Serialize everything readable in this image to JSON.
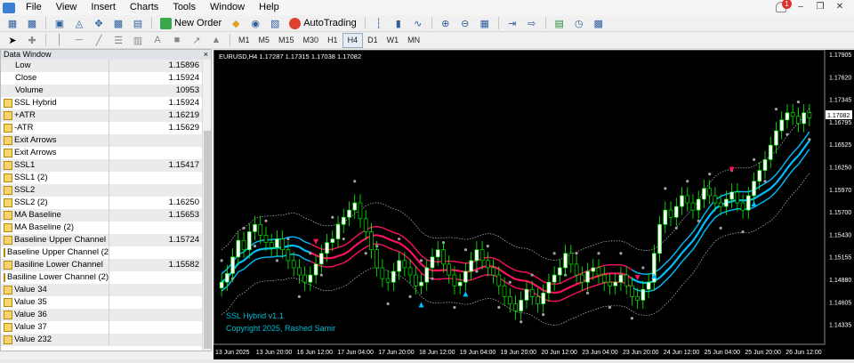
{
  "menu": {
    "items": [
      "File",
      "View",
      "Insert",
      "Charts",
      "Tools",
      "Window",
      "Help"
    ],
    "notifications": "1"
  },
  "toolbar": {
    "new_order": "New Order",
    "autotrading": "AutoTrading",
    "timeframes": [
      "M1",
      "M5",
      "M15",
      "M30",
      "H1",
      "H4",
      "D1",
      "W1",
      "MN"
    ],
    "active_timeframe": "H4"
  },
  "data_window": {
    "title": "Data Window",
    "rows": [
      {
        "name": "Low",
        "value": "1.15896",
        "indicator": false
      },
      {
        "name": "Close",
        "value": "1.15924",
        "indicator": false
      },
      {
        "name": "Volume",
        "value": "10953",
        "indicator": false
      },
      {
        "name": "SSL Hybrid",
        "value": "1.15924",
        "indicator": true
      },
      {
        "name": "+ATR",
        "value": "1.16219",
        "indicator": true
      },
      {
        "name": "-ATR",
        "value": "1.15629",
        "indicator": true
      },
      {
        "name": "Exit Arrows",
        "value": "",
        "indicator": true
      },
      {
        "name": "Exit Arrows",
        "value": "",
        "indicator": true
      },
      {
        "name": "SSL1",
        "value": "1.15417",
        "indicator": true
      },
      {
        "name": "SSL1 (2)",
        "value": "",
        "indicator": true
      },
      {
        "name": "SSL2",
        "value": "",
        "indicator": true
      },
      {
        "name": "SSL2 (2)",
        "value": "1.16250",
        "indicator": true
      },
      {
        "name": "MA Baseline",
        "value": "1.15653",
        "indicator": true
      },
      {
        "name": "MA Baseline (2)",
        "value": "",
        "indicator": true
      },
      {
        "name": "Baseline Upper Channel",
        "value": "1.15724",
        "indicator": true
      },
      {
        "name": "Baseline Upper Channel (2)",
        "value": "",
        "indicator": true
      },
      {
        "name": "Basiline Lower Channel",
        "value": "1.15582",
        "indicator": true
      },
      {
        "name": "Basiline Lower Channel (2)",
        "value": "",
        "indicator": true
      },
      {
        "name": "Value 34",
        "value": "",
        "indicator": true
      },
      {
        "name": "Value 35",
        "value": "",
        "indicator": true
      },
      {
        "name": "Value 36",
        "value": "",
        "indicator": true
      },
      {
        "name": "Value 37",
        "value": "",
        "indicator": true
      },
      {
        "name": "Value 232",
        "value": "",
        "indicator": true
      }
    ]
  },
  "chart": {
    "header": "EURUSD,H4  1.17287 1.17315 1.17038 1.17082",
    "current_price": "1.17082",
    "watermark_line1": "SSL Hybrid  v1.1",
    "watermark_line2": "Copyright 2025, Rashed Samir",
    "price_labels": [
      "1.17905",
      "1.17620",
      "1.17345",
      "1.16795",
      "1.16525",
      "1.16250",
      "1.15970",
      "1.15700",
      "1.15430",
      "1.15155",
      "1.14880",
      "1.14605",
      "1.14335"
    ],
    "time_labels": [
      "13 Jun 2025",
      "13 Jun 20:00",
      "16 Jun 12:00",
      "17 Jun 04:00",
      "17 Jun 20:00",
      "18 Jun 12:00",
      "19 Jun 04:00",
      "19 Jun 20:00",
      "20 Jun 12:00",
      "23 Jun 04:00",
      "23 Jun 20:00",
      "24 Jun 12:00",
      "25 Jun 04:00",
      "25 Jun 20:00",
      "26 Jun 12:00"
    ],
    "colors": {
      "background": "#000000",
      "bull_candle": "#ffffff",
      "bear_candle": "#000000",
      "wick": "#00ff00",
      "ssl_up": "#00bfff",
      "ssl_down": "#ff1060",
      "atr_band": "#c0c0c0",
      "dots": "#a0a0a0",
      "watermark": "#00bcd4"
    }
  },
  "chart_data": {
    "type": "line",
    "title": "EURUSD,H4",
    "ylim": [
      1.142,
      1.1805
    ],
    "closes": [
      1.15,
      1.1512,
      1.1535,
      1.1558,
      1.1545,
      1.157,
      1.158,
      1.1565,
      1.1555,
      1.1548,
      1.156,
      1.1545,
      1.153,
      1.152,
      1.151,
      1.15,
      1.151,
      1.1525,
      1.154,
      1.1555,
      1.156,
      1.158,
      1.159,
      1.16,
      1.161,
      1.1588,
      1.157,
      1.1545,
      1.152,
      1.1505,
      1.15,
      1.1515,
      1.153,
      1.152,
      1.151,
      1.1495,
      1.15,
      1.152,
      1.1535,
      1.1545,
      1.1525,
      1.151,
      1.1495,
      1.15,
      1.1515,
      1.153,
      1.1545,
      1.153,
      1.152,
      1.151,
      1.1495,
      1.148,
      1.147,
      1.146,
      1.1475,
      1.149,
      1.148,
      1.147,
      1.1485,
      1.15,
      1.151,
      1.152,
      1.154,
      1.1525,
      1.151,
      1.15,
      1.1515,
      1.152,
      1.151,
      1.15,
      1.1495,
      1.15,
      1.151,
      1.1495,
      1.148,
      1.1475,
      1.149,
      1.15,
      1.154,
      1.158,
      1.16,
      1.159,
      1.1605,
      1.162,
      1.161,
      1.16,
      1.1615,
      1.163,
      1.162,
      1.161,
      1.1605,
      1.1615,
      1.1625,
      1.161,
      1.16,
      1.162,
      1.164,
      1.1655,
      1.167,
      1.169,
      1.171,
      1.1725,
      1.1735,
      1.173,
      1.172,
      1.1735,
      1.1728
    ]
  }
}
